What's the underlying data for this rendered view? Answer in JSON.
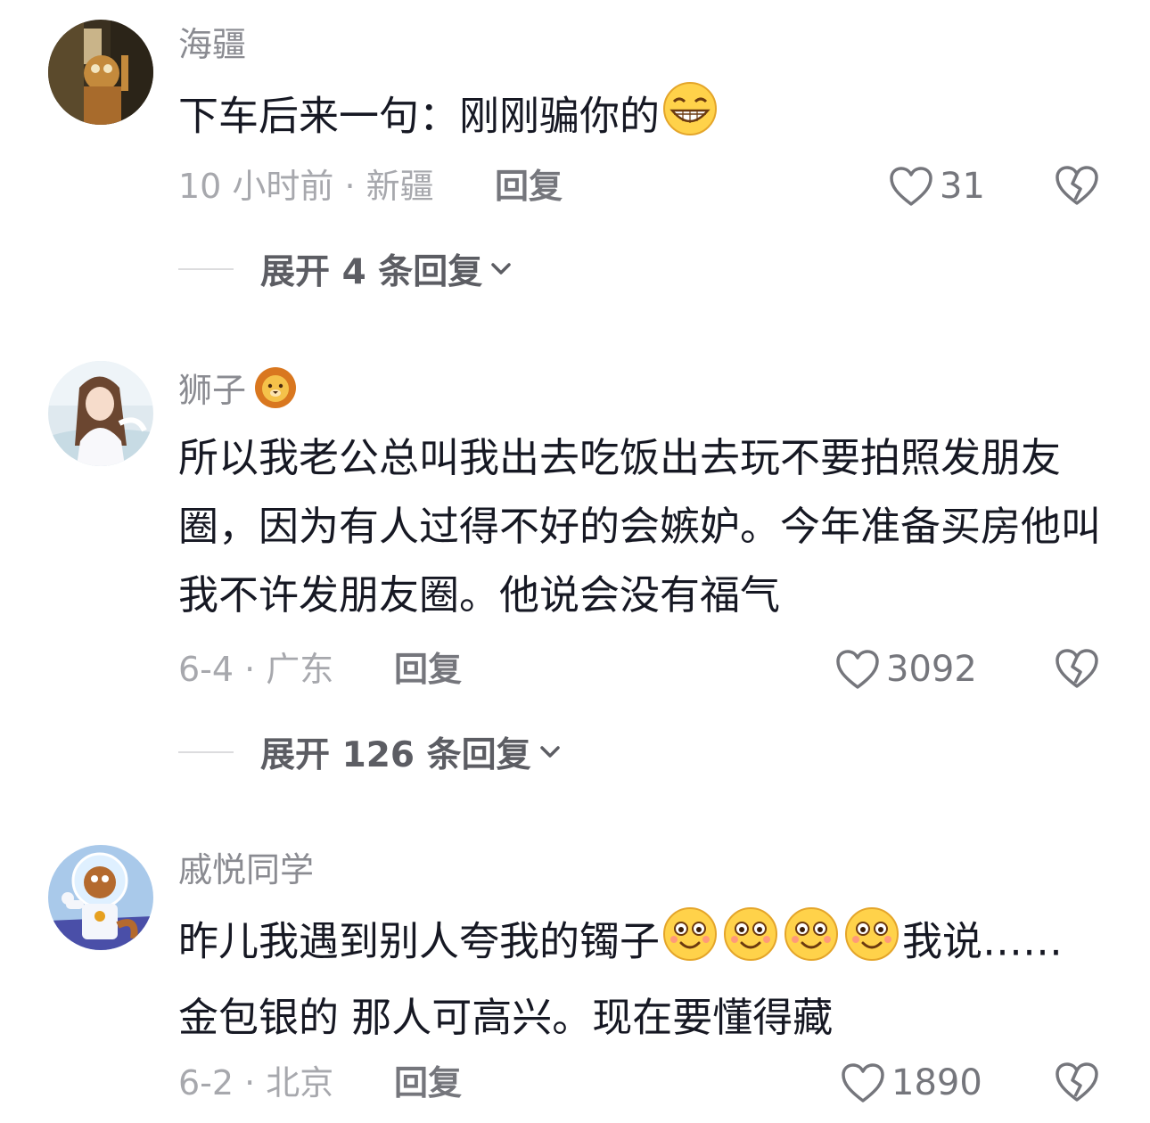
{
  "comments": [
    {
      "username": "海疆",
      "text": "下车后来一句：刚刚骗你的",
      "time_location": "10 小时前 · 新疆",
      "reply_label": "回复",
      "likes": "31",
      "expand_label": "展开 4 条回复"
    },
    {
      "username": "狮子",
      "text": "所以我老公总叫我出去吃饭出去玩不要拍照发朋友圈，因为有人过得不好的会嫉妒。今年准备买房他叫我不许发朋友圈。他说会没有福气",
      "time_location": "6-4 · 广东",
      "reply_label": "回复",
      "likes": "3092",
      "expand_label": "展开 126 条回复"
    },
    {
      "username": "戚悦同学",
      "text_part1": "昨儿我遇到别人夸我的镯子",
      "text_part2": "我说……金包银的 那人可高兴。现在要懂得藏",
      "time_location": "6-2 · 北京",
      "reply_label": "回复",
      "likes": "1890"
    }
  ],
  "icons": {
    "like": "heart-outline-icon",
    "dislike": "broken-heart-icon",
    "expand": "chevron-down-icon",
    "emoji_grin": "grin-emoji",
    "emoji_lion": "lion-emoji",
    "emoji_smile": "smile-emoji"
  },
  "colors": {
    "text_primary": "#161823",
    "text_secondary": "#8a8b91",
    "icon_gray": "#75767c"
  }
}
